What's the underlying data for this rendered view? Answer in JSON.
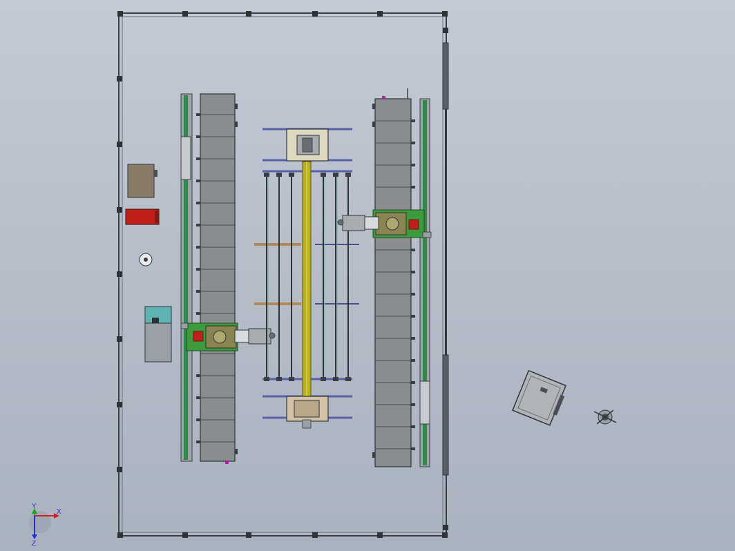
{
  "viewport": {
    "kind": "CAD top view"
  },
  "triad": {
    "x_label": "X",
    "y_label": "Y",
    "z_label": "Z"
  },
  "colors": {
    "background": "#b9c0cb",
    "frame": "#3a3f45",
    "conveyor": "#8a8d90",
    "rail_green": "#2f8a4a",
    "slat": "#5860a8",
    "shaft": "#b8b020",
    "robot_base": "#3d9a3d",
    "cabinet_red": "#c0201c",
    "cabinet_teal": "#5fb3b3",
    "box_brown": "#8a7b68",
    "axis_x": "#d02020",
    "axis_y": "#20a020",
    "axis_z": "#2030d0"
  },
  "components": [
    {
      "id": "perimeter-frame",
      "icon": "frame-icon"
    },
    {
      "id": "left-conveyor",
      "icon": "conveyor-icon"
    },
    {
      "id": "right-conveyor",
      "icon": "conveyor-icon"
    },
    {
      "id": "center-gantry",
      "icon": "gantry-icon"
    },
    {
      "id": "left-robot",
      "icon": "robot-icon"
    },
    {
      "id": "right-robot",
      "icon": "robot-icon"
    },
    {
      "id": "control-box",
      "icon": "box-icon"
    },
    {
      "id": "red-cabinet",
      "icon": "cabinet-icon"
    },
    {
      "id": "round-fixture",
      "icon": "fixture-icon"
    },
    {
      "id": "teal-cabinet",
      "icon": "cabinet-icon"
    },
    {
      "id": "loose-panel",
      "icon": "panel-icon"
    },
    {
      "id": "loose-part",
      "icon": "part-icon"
    }
  ]
}
